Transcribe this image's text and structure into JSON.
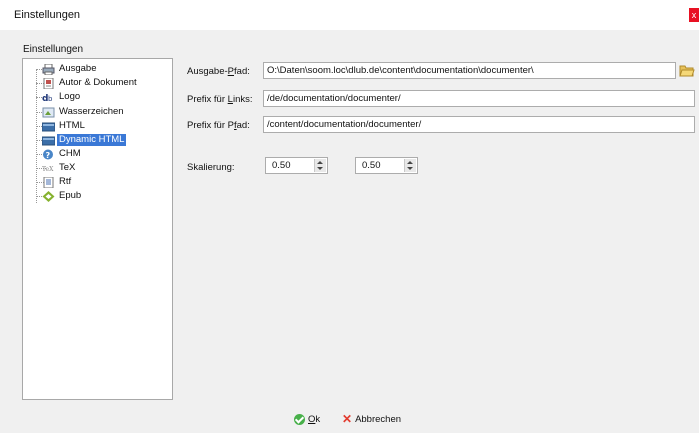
{
  "window": {
    "title": "Einstellungen",
    "close_glyph": "x"
  },
  "tree": {
    "group_label": "Einstellungen",
    "items": [
      {
        "label": "Ausgabe",
        "icon": "printer-icon"
      },
      {
        "label": "Autor & Dokument",
        "icon": "document-author-icon"
      },
      {
        "label": "Logo",
        "icon": "logo-icon"
      },
      {
        "label": "Wasserzeichen",
        "icon": "watermark-icon"
      },
      {
        "label": "HTML",
        "icon": "html-icon"
      },
      {
        "label": "Dynamic HTML",
        "icon": "dynamic-html-icon",
        "selected": true
      },
      {
        "label": "CHM",
        "icon": "chm-help-icon"
      },
      {
        "label": "TeX",
        "icon": "tex-icon"
      },
      {
        "label": "Rtf",
        "icon": "rtf-icon"
      },
      {
        "label": "Epub",
        "icon": "epub-icon"
      }
    ]
  },
  "form": {
    "output_path": {
      "label_pre": "Ausgabe-",
      "label_u": "P",
      "label_post": "fad:",
      "value": "O:\\Daten\\soom.loc\\dlub.de\\content\\documentation\\documenter\\"
    },
    "prefix_links": {
      "label_pre": "Prefix für ",
      "label_u": "L",
      "label_post": "inks:",
      "value": "/de/documentation/documenter/"
    },
    "prefix_path": {
      "label_pre": "Prefix für P",
      "label_u": "f",
      "label_post": "ad:",
      "value": "/content/documentation/documenter/"
    },
    "scaling": {
      "label": "Skalierung:",
      "value_x": "0.50",
      "value_y": "0.50"
    }
  },
  "buttons": {
    "ok_u": "O",
    "ok_rest": "k",
    "cancel": "Abbrechen"
  },
  "colors": {
    "selection": "#3a78d6",
    "close": "#e81123",
    "ok": "#48b04a",
    "cancel": "#e23b2e"
  }
}
